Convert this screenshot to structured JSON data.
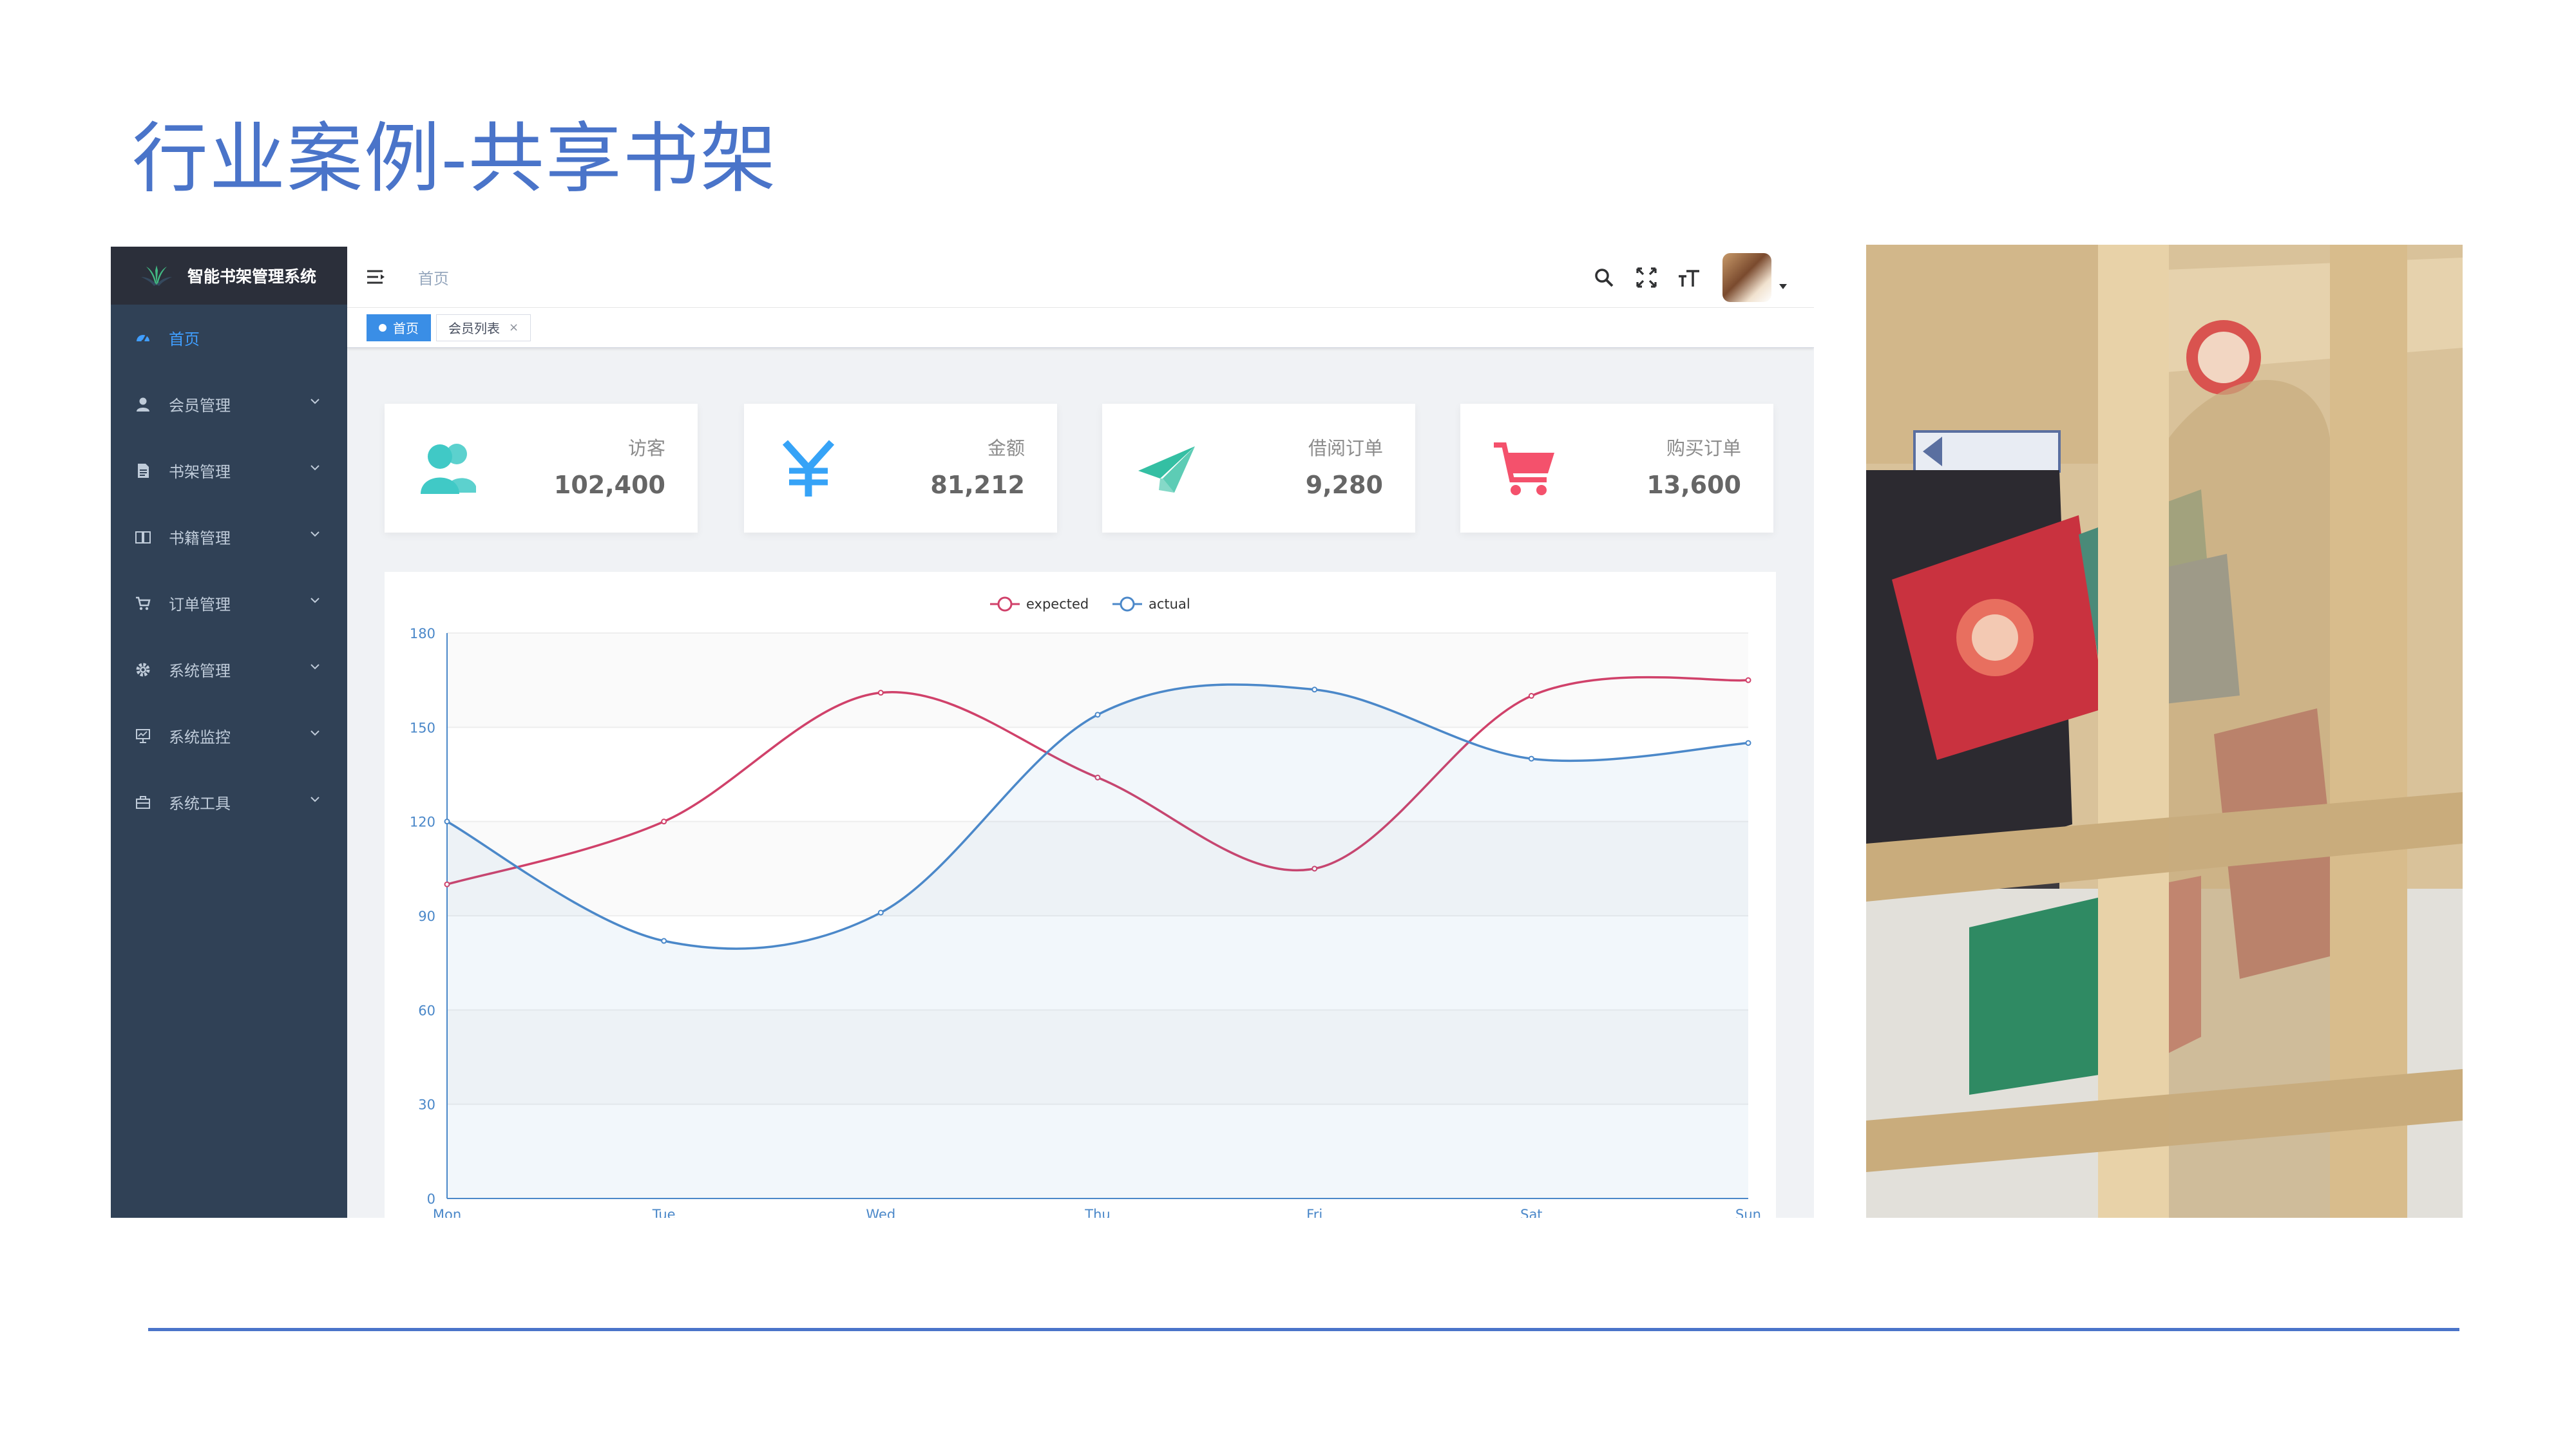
{
  "slide": {
    "title": "行业案例-共享书架"
  },
  "app": {
    "logo_text": "智能书架管理系统",
    "sidebar": {
      "items": [
        {
          "label": "首页",
          "icon": "dashboard-icon",
          "active": true,
          "has_submenu": false
        },
        {
          "label": "会员管理",
          "icon": "user-icon",
          "active": false,
          "has_submenu": true
        },
        {
          "label": "书架管理",
          "icon": "document-icon",
          "active": false,
          "has_submenu": true
        },
        {
          "label": "书籍管理",
          "icon": "book-icon",
          "active": false,
          "has_submenu": true
        },
        {
          "label": "订单管理",
          "icon": "cart-icon",
          "active": false,
          "has_submenu": true
        },
        {
          "label": "系统管理",
          "icon": "gear-icon",
          "active": false,
          "has_submenu": true
        },
        {
          "label": "系统监控",
          "icon": "monitor-icon",
          "active": false,
          "has_submenu": true
        },
        {
          "label": "系统工具",
          "icon": "toolbox-icon",
          "active": false,
          "has_submenu": true
        }
      ]
    },
    "navbar": {
      "breadcrumb": "首页",
      "icons": [
        "search-icon",
        "fullscreen-icon",
        "font-size-icon",
        "avatar"
      ]
    },
    "tags": [
      {
        "label": "首页",
        "active": true
      },
      {
        "label": "会员列表",
        "active": false,
        "close": "×"
      }
    ],
    "panels": [
      {
        "label": "访客",
        "value": "102,400",
        "icon": "visitors-icon",
        "color": "#40c9c6"
      },
      {
        "label": "金额",
        "value": "81,212",
        "icon": "yuan-icon",
        "color": "#36a3f7"
      },
      {
        "label": "借阅订单",
        "value": "9,280",
        "icon": "paper-plane-icon",
        "color": "#34bfa3"
      },
      {
        "label": "购买订单",
        "value": "13,600",
        "icon": "shopping-cart-icon",
        "color": "#f4516c"
      }
    ]
  },
  "chart_data": {
    "type": "line",
    "categories": [
      "Mon",
      "Tue",
      "Wed",
      "Thu",
      "Fri",
      "Sat",
      "Sun"
    ],
    "series": [
      {
        "name": "expected",
        "values": [
          100,
          120,
          161,
          134,
          105,
          160,
          165
        ],
        "color": "#d0416a"
      },
      {
        "name": "actual",
        "values": [
          120,
          82,
          91,
          154,
          162,
          140,
          145
        ],
        "color": "#4b88c9"
      }
    ],
    "ylim": [
      0,
      180
    ],
    "yticks": [
      0,
      30,
      60,
      90,
      120,
      150,
      180
    ],
    "legend": "top-center",
    "smooth": true
  }
}
